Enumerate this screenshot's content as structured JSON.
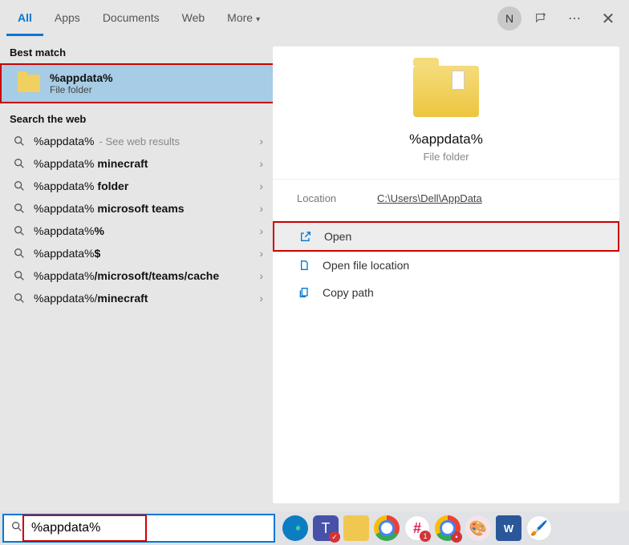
{
  "tabs": {
    "all": "All",
    "apps": "Apps",
    "documents": "Documents",
    "web": "Web",
    "more": "More"
  },
  "avatar_letter": "N",
  "sections": {
    "best_match": "Best match",
    "search_web": "Search the web"
  },
  "best_match": {
    "title": "%appdata%",
    "subtitle": "File folder"
  },
  "web_results": [
    {
      "text": "%appdata%",
      "bold": "",
      "hint": "- See web results"
    },
    {
      "text": "%appdata%",
      "bold": " minecraft",
      "hint": ""
    },
    {
      "text": "%appdata%",
      "bold": " folder",
      "hint": ""
    },
    {
      "text": "%appdata%",
      "bold": " microsoft teams",
      "hint": ""
    },
    {
      "text": "%appdata%",
      "bold": "%",
      "hint": ""
    },
    {
      "text": "%appdata%",
      "bold": "$",
      "hint": ""
    },
    {
      "text": "%appdata%",
      "bold": "/microsoft/teams/cache",
      "hint": ""
    },
    {
      "text": "%appdata%/",
      "bold": "minecraft",
      "hint": ""
    }
  ],
  "preview": {
    "title": "%appdata%",
    "subtitle": "File folder",
    "location_label": "Location",
    "location_path": "C:\\Users\\Dell\\AppData",
    "actions": {
      "open": "Open",
      "open_location": "Open file location",
      "copy_path": "Copy path"
    }
  },
  "searchbox": {
    "value": "%appdata%"
  }
}
